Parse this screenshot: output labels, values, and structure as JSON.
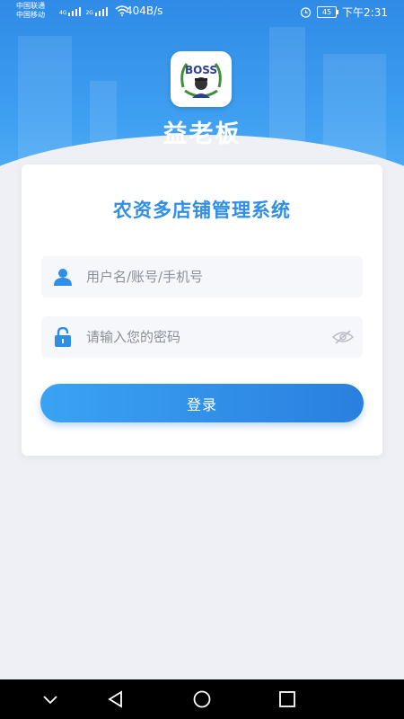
{
  "status_bar": {
    "carrier_1": "中国联通",
    "carrier_2": "中国移动",
    "network_1": "4G",
    "network_2": "2G",
    "speed": "404B/s",
    "battery": "45",
    "time": "下午2:31"
  },
  "app": {
    "logo_text": "BOSS",
    "name": "益老板"
  },
  "login": {
    "title": "农资多店铺管理系统",
    "username_placeholder": "用户名/账号/手机号",
    "username_value": "",
    "password_placeholder": "请输入您的密码",
    "password_value": "",
    "submit_label": "登录"
  },
  "icons": {
    "user": "user-icon",
    "lock": "lock-icon",
    "eye": "eye-hidden-icon",
    "nav_down": "chevron-down-icon",
    "nav_back": "back-triangle-icon",
    "nav_home": "home-circle-icon",
    "nav_recent": "recent-square-icon"
  },
  "colors": {
    "primary": "#2e8ee8",
    "button_start": "#3aa3f3",
    "button_end": "#2a7fdf",
    "background": "#eef0f5",
    "input_bg": "#f6f7fa"
  }
}
